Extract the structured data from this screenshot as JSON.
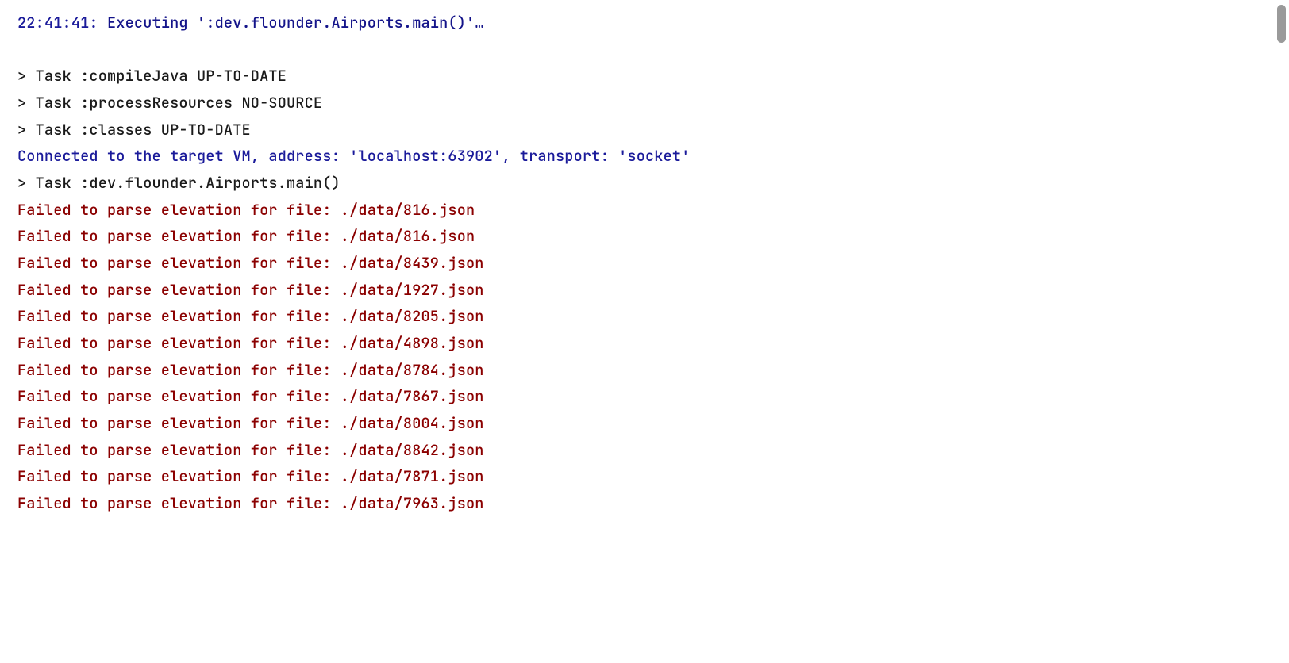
{
  "timestamp": "22:41:41",
  "executing_label": "Executing",
  "executing_command": "':dev.flounder.Airports.main()'…",
  "tasks": [
    "> Task :compileJava UP-TO-DATE",
    "> Task :processResources NO-SOURCE",
    "> Task :classes UP-TO-DATE"
  ],
  "vm_line": "Connected to the target VM, address: 'localhost:63902', transport: 'socket'",
  "task_main": "> Task :dev.flounder.Airports.main()",
  "error_prefix": "Failed to parse elevation for file: ",
  "error_files": [
    "./data/816.json",
    "./data/816.json",
    "./data/8439.json",
    "./data/1927.json",
    "./data/8205.json",
    "./data/4898.json",
    "./data/8784.json",
    "./data/7867.json",
    "./data/8004.json",
    "./data/8842.json",
    "./data/7871.json",
    "./data/7963.json"
  ]
}
